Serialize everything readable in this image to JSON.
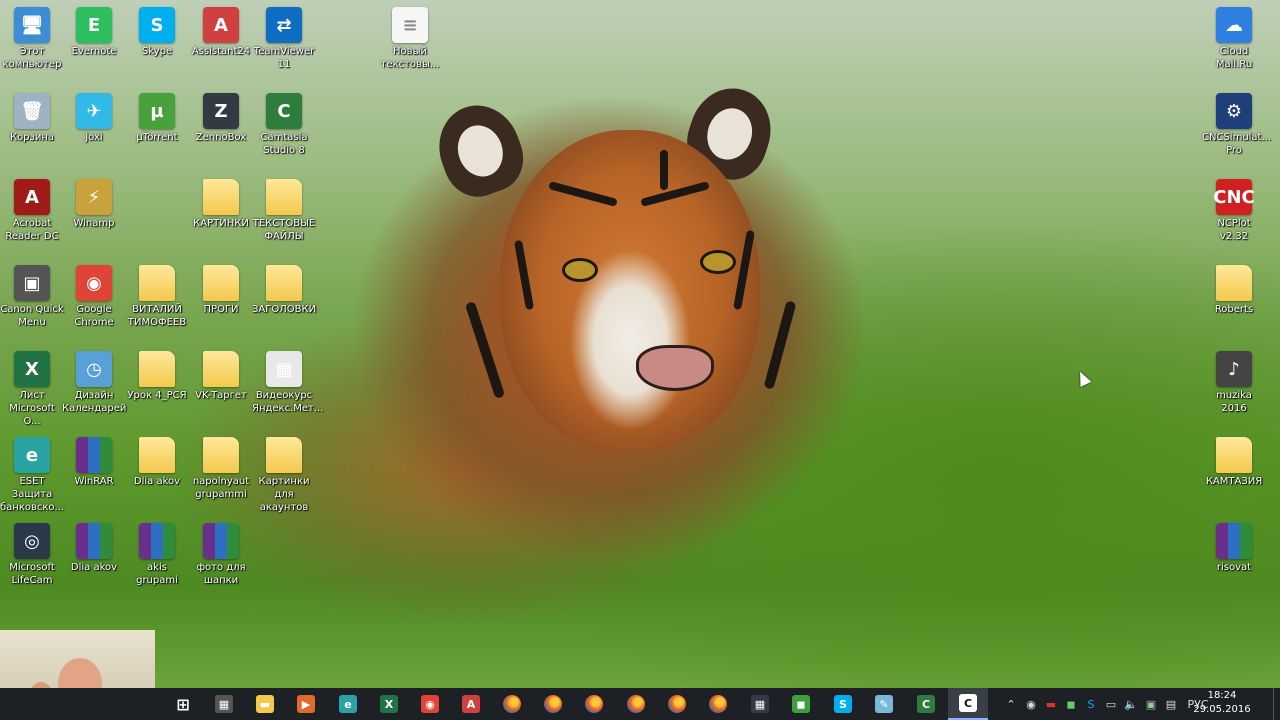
{
  "desktop": {
    "icons": [
      {
        "label": "Этот\nкомпьютер",
        "glyph": "🖥",
        "color": "#3b8ed6"
      },
      {
        "label": "Evernote",
        "glyph": "E",
        "color": "#2dbe60"
      },
      {
        "label": "Skype",
        "glyph": "S",
        "color": "#00aff0"
      },
      {
        "label": "Assistant24",
        "glyph": "A",
        "color": "#d04040"
      },
      {
        "label": "TeamViewer\n11",
        "glyph": "⇄",
        "color": "#0e6dc2"
      },
      {
        "label": "Новый\nтекстовы...",
        "glyph": "≡",
        "color": "#f6f6f6"
      },
      {
        "label": "Корзина",
        "glyph": "🗑",
        "color": "#9fb2c2"
      },
      {
        "label": "joxi",
        "glyph": "✈",
        "color": "#33b9e8"
      },
      {
        "label": "µTorrent",
        "glyph": "µ",
        "color": "#48a23c"
      },
      {
        "label": "ZennoBox",
        "glyph": "Z",
        "color": "#333a44"
      },
      {
        "label": "Camtasia\nStudio 8",
        "glyph": "C",
        "color": "#2f7d3c"
      },
      {
        "label": "Acrobat\nReader DC",
        "glyph": "A",
        "color": "#a01a1a"
      },
      {
        "label": "Winamp",
        "glyph": "⚡",
        "color": "#c9a23c"
      },
      {
        "label": "КАРТИНКИ",
        "glyph": "",
        "color": "#f3c94d"
      },
      {
        "label": "ТЕКСТОВЫЕ\nФАЙЛЫ",
        "glyph": "",
        "color": "#f3c94d"
      },
      {
        "label": "Canon Quick\nMenu",
        "glyph": "▣",
        "color": "#555"
      },
      {
        "label": "Google\nChrome",
        "glyph": "◉",
        "color": "#e04436"
      },
      {
        "label": "ВИТАЛИЙ\nТИМОФЕЕВ",
        "glyph": "",
        "color": "#f3c94d"
      },
      {
        "label": "ПРОГИ",
        "glyph": "",
        "color": "#f3c94d"
      },
      {
        "label": "ЗАГОЛОВКИ",
        "glyph": "",
        "color": "#f3c94d"
      },
      {
        "label": "Лист\nMicrosoft O...",
        "glyph": "X",
        "color": "#217346"
      },
      {
        "label": "Дизайн\nКалендарей",
        "glyph": "◷",
        "color": "#5aa0d8"
      },
      {
        "label": "Урок 4_РСЯ",
        "glyph": "",
        "color": "#f3c94d"
      },
      {
        "label": "VK-Таргет",
        "glyph": "",
        "color": "#f3c94d"
      },
      {
        "label": "Видеокурс\nЯндекс.Мет...",
        "glyph": "▦",
        "color": "#e8e8e8"
      },
      {
        "label": "ESET Защита\nбанковско...",
        "glyph": "e",
        "color": "#2aa3a3"
      },
      {
        "label": "WinRAR",
        "glyph": "",
        "color": "#6a2f8c"
      },
      {
        "label": "Dlia akov",
        "glyph": "",
        "color": "#f3c94d"
      },
      {
        "label": "napolnyaut\ngrupammi",
        "glyph": "",
        "color": "#f3c94d"
      },
      {
        "label": "Картинки\nдля акаунтов",
        "glyph": "",
        "color": "#f3c94d"
      },
      {
        "label": "Microsoft\nLifeCam",
        "glyph": "◎",
        "color": "#2a3a4a"
      },
      {
        "label": "Dlia akov",
        "glyph": "",
        "color": "#6a2f8c"
      },
      {
        "label": "akis grupami",
        "glyph": "",
        "color": "#6a2f8c"
      },
      {
        "label": "фото для\nшапки",
        "glyph": "",
        "color": "#6a2f8c"
      },
      {
        "label": "Cloud\nMail.Ru",
        "glyph": "☁",
        "color": "#2f7fe0"
      },
      {
        "label": "CNCSimulat...\nPro",
        "glyph": "⚙",
        "color": "#1f3f7a"
      },
      {
        "label": "NCPlot v2.32",
        "glyph": "CNC",
        "color": "#d02020"
      },
      {
        "label": "Roberts",
        "glyph": "",
        "color": "#f3c94d"
      },
      {
        "label": "muzika 2016",
        "glyph": "♪",
        "color": "#444"
      },
      {
        "label": "КАМТАЗИЯ",
        "glyph": "",
        "color": "#f3c94d"
      },
      {
        "label": "risovat",
        "glyph": "",
        "color": "#6a2f8c"
      }
    ]
  },
  "taskbar": {
    "apps": [
      {
        "name": "start",
        "glyph": "⊞",
        "color": "#1d2025"
      },
      {
        "name": "calculator",
        "glyph": "▦",
        "color": "#555"
      },
      {
        "name": "file-explorer",
        "glyph": "▬",
        "color": "#f3c94d"
      },
      {
        "name": "media",
        "glyph": "▶",
        "color": "#e06a2a"
      },
      {
        "name": "eset",
        "glyph": "e",
        "color": "#2aa3a3"
      },
      {
        "name": "excel",
        "glyph": "X",
        "color": "#217346"
      },
      {
        "name": "chrome",
        "glyph": "◉",
        "color": "#e04436"
      },
      {
        "name": "assistant",
        "glyph": "A",
        "color": "#d04040"
      },
      {
        "name": "firefox-1",
        "glyph": "",
        "color": "#f06a1f"
      },
      {
        "name": "firefox-2",
        "glyph": "",
        "color": "#f06a1f"
      },
      {
        "name": "firefox-3",
        "glyph": "",
        "color": "#f06a1f"
      },
      {
        "name": "firefox-4",
        "glyph": "",
        "color": "#f06a1f"
      },
      {
        "name": "firefox-5",
        "glyph": "",
        "color": "#f06a1f"
      },
      {
        "name": "firefox-6",
        "glyph": "",
        "color": "#f06a1f"
      },
      {
        "name": "calculator-2",
        "glyph": "▦",
        "color": "#333a44"
      },
      {
        "name": "app-green",
        "glyph": "◼",
        "color": "#3ca03c"
      },
      {
        "name": "skype",
        "glyph": "S",
        "color": "#00aff0"
      },
      {
        "name": "notepad",
        "glyph": "✎",
        "color": "#7ab8d8"
      },
      {
        "name": "camtasia",
        "glyph": "C",
        "color": "#2f7d3c"
      },
      {
        "name": "camtasia-recorder",
        "glyph": "C",
        "color": "#111"
      }
    ],
    "tray": {
      "language": "РУС",
      "time": "18:24",
      "date": "29.05.2016"
    }
  }
}
